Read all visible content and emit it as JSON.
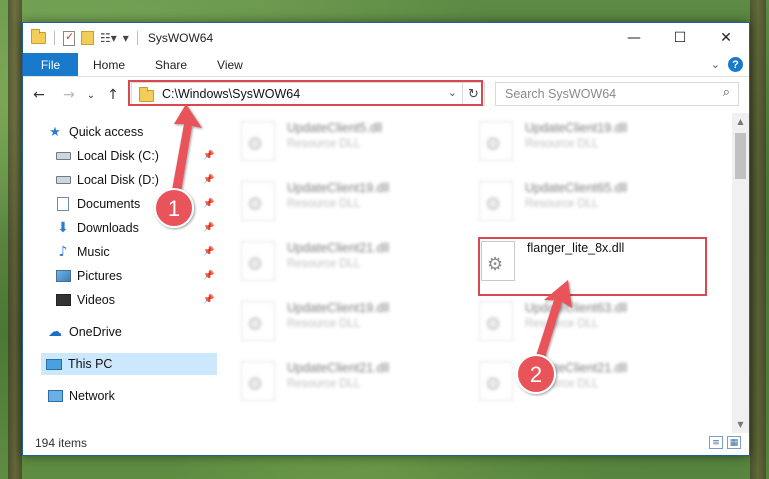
{
  "window": {
    "title": "SysWOW64",
    "minimize": "—",
    "maximize": "☐",
    "close": "✕"
  },
  "ribbon": {
    "file": "File",
    "tabs": [
      "Home",
      "Share",
      "View"
    ],
    "expand": "⌄",
    "help": "?"
  },
  "nav": {
    "back": "←",
    "forward": "→",
    "recent": "⌄",
    "up": "↑"
  },
  "address": {
    "path": "C:\\Windows\\SysWOW64",
    "dropdown": "⌄",
    "refresh": "↻"
  },
  "search": {
    "placeholder": "Search SysWOW64",
    "icon": "⌕"
  },
  "sidebar": {
    "items": [
      {
        "label": "Quick access",
        "icon": "star-icon"
      },
      {
        "label": "Local Disk (C:)",
        "icon": "disk-icon",
        "pinned": true
      },
      {
        "label": "Local Disk (D:)",
        "icon": "disk-icon",
        "pinned": true
      },
      {
        "label": "Documents",
        "icon": "documents-icon",
        "pinned": true
      },
      {
        "label": "Downloads",
        "icon": "download-icon",
        "pinned": true
      },
      {
        "label": "Music",
        "icon": "music-icon",
        "pinned": true
      },
      {
        "label": "Pictures",
        "icon": "pictures-icon",
        "pinned": true
      },
      {
        "label": "Videos",
        "icon": "videos-icon",
        "pinned": true
      },
      {
        "label": "OneDrive",
        "icon": "cloud-icon"
      },
      {
        "label": "This PC",
        "icon": "computer-icon",
        "selected": true
      },
      {
        "label": "Network",
        "icon": "network-icon"
      }
    ],
    "pin_glyph": "📌"
  },
  "files": [
    {
      "name": "UpdateClient5.dll",
      "type": "Resource DLL",
      "blurred": true
    },
    {
      "name": "UpdateClient19.dll",
      "type": "Resource DLL",
      "blurred": true
    },
    {
      "name": "UpdateClient19.dll",
      "type": "Resource DLL",
      "blurred": true
    },
    {
      "name": "UpdateClient65.dll",
      "type": "Resource DLL",
      "blurred": true
    },
    {
      "name": "UpdateClient21.dll",
      "type": "Resource DLL",
      "blurred": true
    },
    {
      "name": "flanger_lite_8x.dll",
      "type": "",
      "blurred": false
    },
    {
      "name": "UpdateClient19.dll",
      "type": "Resource DLL",
      "blurred": true
    },
    {
      "name": "UpdateClient63.dll",
      "type": "Resource DLL",
      "blurred": true
    },
    {
      "name": "UpdateClient21.dll",
      "type": "Resource DLL",
      "blurred": true
    },
    {
      "name": "UpdateClient21.dll",
      "type": "Resource DLL",
      "blurred": true
    }
  ],
  "status": {
    "count": "194 items"
  },
  "annotations": {
    "marker1": "1",
    "marker2": "2",
    "color": "#d8484e"
  }
}
